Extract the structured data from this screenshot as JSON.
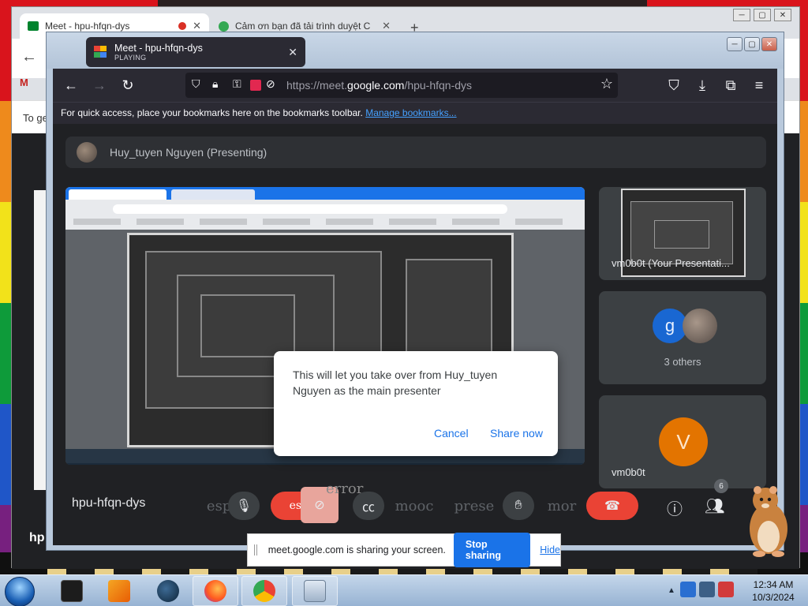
{
  "bg_browser": {
    "tab1_title": "Meet - hpu-hfqn-dys",
    "tab2_title": "Cảm ơn bạn đã tải trình duyệt C",
    "new_tab": "+",
    "info_text": "To ge",
    "gmail_letter": "M",
    "left_label": "hp"
  },
  "firefox": {
    "tab": {
      "title": "Meet - hpu-hfqn-dys",
      "subtitle": "PLAYING"
    },
    "url": {
      "prefix": "https://meet.",
      "domain": "google.com",
      "path": "/hpu-hfqn-dys"
    },
    "bookmarks": {
      "message": "For quick access, place your bookmarks here on the bookmarks toolbar.",
      "link": "Manage bookmarks..."
    }
  },
  "meet": {
    "presenter_banner": "Huy_tuyen Nguyen (Presenting)",
    "tiles": {
      "self_label": "vm0b0t (Your Presentati...",
      "others_initial": "g",
      "others_label": "3 others",
      "user_initial": "V",
      "user_label": "vm0b0t"
    },
    "meeting_code": "hpu-hfqn-dys",
    "controls": {
      "labels": [
        "espa",
        "espa",
        "mooc",
        "prese",
        "mor"
      ],
      "error_text": "error",
      "people_count": "6"
    },
    "dialog": {
      "message": "This will let you take over from Huy_tuyen Nguyen as the main presenter",
      "cancel": "Cancel",
      "confirm": "Share now"
    }
  },
  "share_bar": {
    "message": "meet.google.com is sharing your screen.",
    "stop": "Stop sharing",
    "hide": "Hide"
  },
  "taskbar": {
    "time": "12:34 AM",
    "date": "10/3/2024"
  },
  "colors": {
    "meet_bg": "#202124",
    "accent_blue": "#1a73e8",
    "end_call_red": "#ea4335",
    "avatar_orange": "#e37400"
  }
}
